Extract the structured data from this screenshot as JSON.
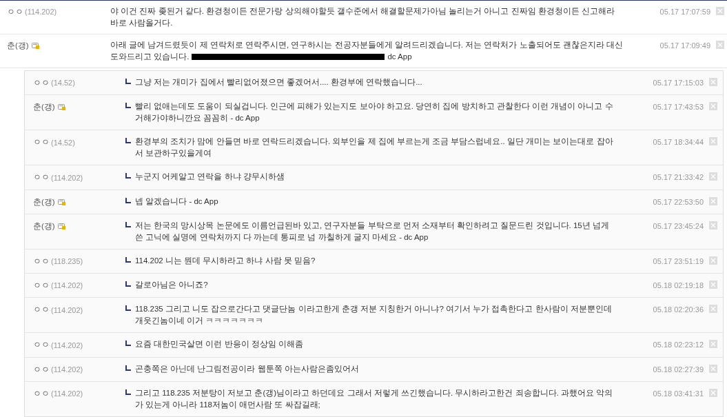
{
  "comments": [
    {
      "kind": "anon",
      "nick": "ㅇㅇ",
      "ip": "(114.202)",
      "text": "야 이건 진짜 좆된거 같다. 환경청이든 전문가랑 상의해야할듯 갤수준에서 해결할문제가아님 놀리는거 아니고 진짜임 환경청이든 신고해라 바로 사람올거다.",
      "date": "05.17 17:07:59"
    },
    {
      "kind": "member",
      "nick": "춘(갱)",
      "lines": [
        "아래 글에 남겨드렸듯이 제 연락처로 연락주시면, 연구하시는 전공자분들에게 알려드리겠습니다. 저는 연락처가 노출되어도 괜찮은지라 대신",
        "도와드리고 있습니다."
      ],
      "redacted": true,
      "text_after": "dc App",
      "date": "05.17 17:09:49"
    }
  ],
  "replies": [
    {
      "kind": "anon",
      "nick": "ㅇㅇ",
      "ip": "(14.52)",
      "text": "그냥 저는 개미가 집에서 빨리없어졌으면 좋겠어서.... 환경부에 연락했습니다...",
      "date": "05.17 17:15:03"
    },
    {
      "kind": "member",
      "nick": "춘(갱)",
      "text": "빨리 없애는데도 도움이 되실겁니다. 인근에 피해가 있는지도 보아야 하고요. 당연히 집에 방치하고 관찰한다 이런 개념이 아니고 수거해가야하니깐요 꼼꼼히 - dc App",
      "date": "05.17 17:43:53"
    },
    {
      "kind": "anon",
      "nick": "ㅇㅇ",
      "ip": "(14.52)",
      "text": "환경부의 조치가 맘에 안들면 바로 연락드리겠습니다. 외부인을 제 집에 부르는게 조금 부담스럽네요.. 일단 개미는 보이는대로 잡아서 보관하구있을게여",
      "date": "05.17 18:34:44"
    },
    {
      "kind": "anon",
      "nick": "ㅇㅇ",
      "ip": "(114.202)",
      "text": "누군지 어케알고 연락을 하냐 걍무시하샘",
      "date": "05.17 21:33:42"
    },
    {
      "kind": "member",
      "nick": "춘(갱)",
      "text": "넵 알겠습니다 - dc App",
      "date": "05.17 22:53:50"
    },
    {
      "kind": "member",
      "nick": "춘(갱)",
      "text": "저는 한국의 망시상목 논문에도 이름언급된바 있고, 연구자분들 부탁으로 먼저 소재부터 확인하려고 질문드린 것입니다. 15년 넘게 쓴 고닉에 실명에 연락처까지 다 까는데 통피로 넘 까칠하게 굴지 마세요 - dc App",
      "date": "05.17 23:45:24"
    },
    {
      "kind": "anon",
      "nick": "ㅇㅇ",
      "ip": "(118.235)",
      "text": "114.202 니는 뭔데 무시하라고 하냐 사람 못 믿음?",
      "date": "05.17 23:51:19"
    },
    {
      "kind": "anon",
      "nick": "ㅇㅇ",
      "ip": "(114.202)",
      "text": "갈로아님은 아니죠?",
      "date": "05.18 02:19:18"
    },
    {
      "kind": "anon",
      "nick": "ㅇㅇ",
      "ip": "(114.202)",
      "text": "118.235 그리고 니도 잡으로간다고 댓글단놈 이라고한게 춘갱 저분 지칭한거 아니냐? 여기서 누가 접촉한다고 한사람이 저분뿐인데 개웃긴놈이네 이거 ㅋㅋㅋㅋㅋㅋㅋ",
      "date": "05.18 02:20:36"
    },
    {
      "kind": "anon",
      "nick": "ㅇㅇ",
      "ip": "(114.202)",
      "text": "요즘 대한민국살면 이런 반응이 정상임 이해좀",
      "date": "05.18 02:23:12"
    },
    {
      "kind": "anon",
      "nick": "ㅇㅇ",
      "ip": "(114.202)",
      "text": "곤충쪽은 아닌데 난그림전공이라 웹툰쪽 아는사람은좀있어서",
      "date": "05.18 02:27:39"
    },
    {
      "kind": "anon",
      "nick": "ㅇㅇ",
      "ip": "(114.202)",
      "text": "그리고 118.235 저분탕이 저보고 춘(갱)님이라고 하던데요 그래서 저렇게 쓰긴했습니다. 무시하라고한건 죄송합니다. 과했어요 악의가 있는게 아니라 118저놈이 애먼사람 또 싸잡길래;",
      "date": "05.18 03:41:31"
    }
  ]
}
